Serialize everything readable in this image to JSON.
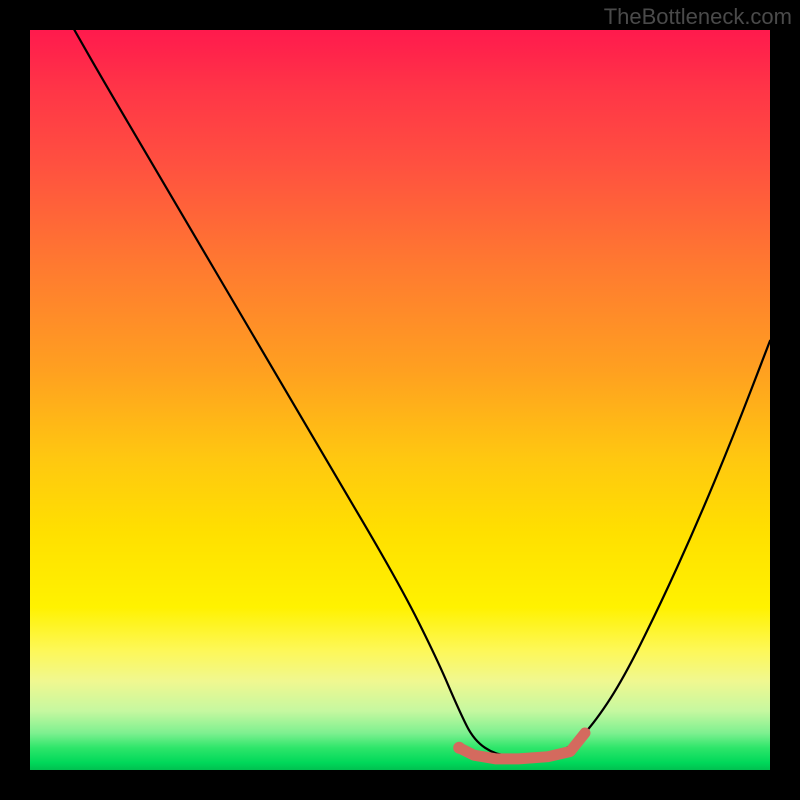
{
  "watermark": "TheBottleneck.com",
  "chart_data": {
    "type": "line",
    "title": "",
    "xlabel": "",
    "ylabel": "",
    "xlim": [
      0,
      100
    ],
    "ylim": [
      0,
      100
    ],
    "series": [
      {
        "name": "bottleneck-curve",
        "type": "path",
        "stroke": "#000000",
        "fill": "none",
        "x": [
          6,
          10,
          20,
          30,
          40,
          50,
          55,
          58,
          60,
          63,
          66,
          70,
          73,
          76,
          80,
          85,
          90,
          95,
          100
        ],
        "y": [
          100,
          93,
          76,
          59,
          42,
          25,
          15,
          8,
          4,
          2,
          2,
          2,
          3,
          6,
          12,
          22,
          33,
          45,
          58
        ]
      },
      {
        "name": "optimal-marker",
        "type": "segment",
        "stroke": "#d46a5e",
        "x": [
          58,
          60,
          63,
          66,
          70,
          73,
          75
        ],
        "y": [
          3.0,
          2.0,
          1.5,
          1.5,
          1.8,
          2.5,
          5.0
        ]
      }
    ],
    "gradient_stops": [
      {
        "pos": 0.0,
        "color": "#ff1a4d"
      },
      {
        "pos": 0.18,
        "color": "#ff5040"
      },
      {
        "pos": 0.46,
        "color": "#ffa020"
      },
      {
        "pos": 0.68,
        "color": "#ffe000"
      },
      {
        "pos": 0.88,
        "color": "#f0f890"
      },
      {
        "pos": 0.97,
        "color": "#2ee66a"
      },
      {
        "pos": 1.0,
        "color": "#00c050"
      }
    ]
  }
}
